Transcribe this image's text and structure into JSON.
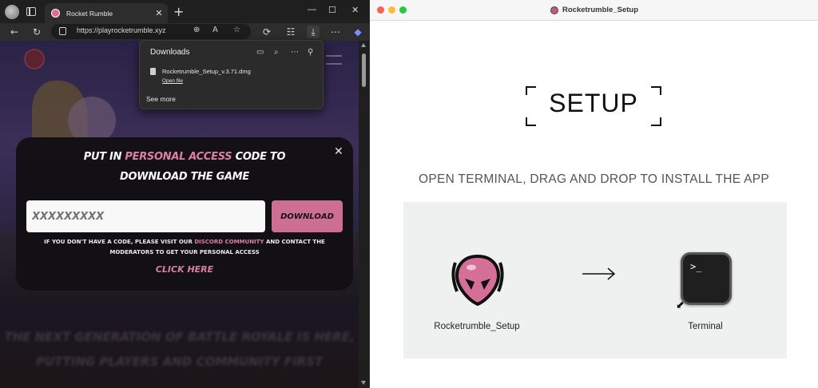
{
  "browser": {
    "tab_title": "Rocket Rumble",
    "tab_close": "✕",
    "new_tab": "+",
    "window_controls": [
      "—",
      "☐",
      "✕"
    ],
    "url": "https://playrocketrumble.xyz",
    "icons": {
      "back": "arrow-left-icon",
      "refresh": "refresh-icon",
      "zoom": "zoom-icon",
      "read_aloud": "read-aloud-icon",
      "favorite": "star-icon",
      "extensions": "puzzle-icon",
      "favorites_bar": "favorites-icon",
      "downloads": "download-icon",
      "more": "more-icon",
      "copilot": "copilot-icon"
    }
  },
  "downloads": {
    "title": "Downloads",
    "file_name": "Rocketrumble_Setup_v.3.71.dmg",
    "open_file": "Open file",
    "see_more": "See more",
    "icons": [
      "folder-icon",
      "search-icon",
      "more-icon",
      "pin-icon"
    ]
  },
  "modal": {
    "title_line1_pre": "PUT IN ",
    "title_line1_accent": "PERSONAL ACCESS",
    "title_line1_post": " CODE TO",
    "title_line2": "DOWNLOAD THE GAME",
    "code_placeholder": "XXXXXXXXX",
    "download_label": "DOWNLOAD",
    "info_line1_pre": "IF YOU DON'T HAVE A CODE, PLEASE VISIT OUR ",
    "info_line1_accent": "DISCORD COMMUNITY",
    "info_line1_post": " AND CONTACT THE",
    "info_line2": "MODERATORS TO GET YOUR PERSONAL ACCESS",
    "click_here": "CLICK HERE",
    "close": "✕"
  },
  "background": {
    "line1": "THE NEXT GENERATION OF BATTLE ROYALE IS HERE,",
    "line2": "PUTTING PLAYERS AND COMMUNITY FIRST"
  },
  "installer": {
    "window_title": "Rocketrumble_Setup",
    "setup_heading": "SETUP",
    "instruction": "OPEN TERMINAL, DRAG AND DROP TO INSTALL THE APP",
    "app_label": "Rocketrumble_Setup",
    "terminal_label": "Terminal",
    "terminal_prompt": ">_",
    "arrow": "→"
  },
  "colors": {
    "accent_pink": "#e084a3",
    "button_pink": "#d27293",
    "code_green": "#5da43f",
    "mac_close": "#fe5f57",
    "mac_min": "#febc2e",
    "mac_max": "#28c840"
  }
}
